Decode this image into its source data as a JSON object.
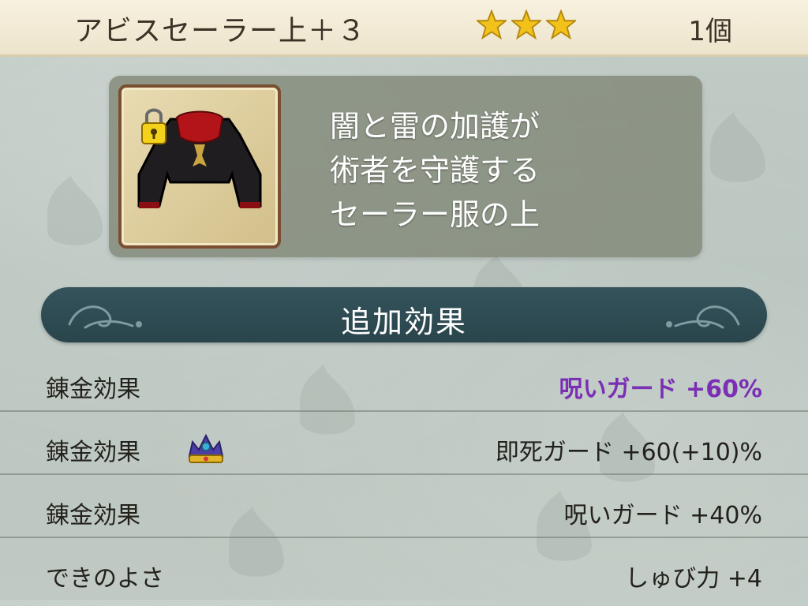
{
  "header": {
    "item_name": "アビスセーラー上＋３",
    "rarity_stars": 3,
    "quantity": "1個"
  },
  "item": {
    "icon": "robe-top-icon",
    "locked": true,
    "description_lines": [
      "闇と雷の加護が",
      "術者を守護する",
      "セーラー服の上"
    ]
  },
  "section": {
    "title": "追加効果"
  },
  "effects": [
    {
      "label": "錬金効果",
      "value": "呪いガード +60%",
      "highlight": true,
      "crown": false
    },
    {
      "label": "錬金効果",
      "value": "即死ガード +60(+10)%",
      "highlight": false,
      "crown": true
    },
    {
      "label": "錬金効果",
      "value": "呪いガード +40%",
      "highlight": false,
      "crown": false
    },
    {
      "label": "できのよさ",
      "value": "しゅび力 +4",
      "highlight": false,
      "crown": false
    }
  ],
  "colors": {
    "star": "#f2c21b",
    "highlight_text": "#7a2fb5",
    "banner": "#2f4b52"
  }
}
